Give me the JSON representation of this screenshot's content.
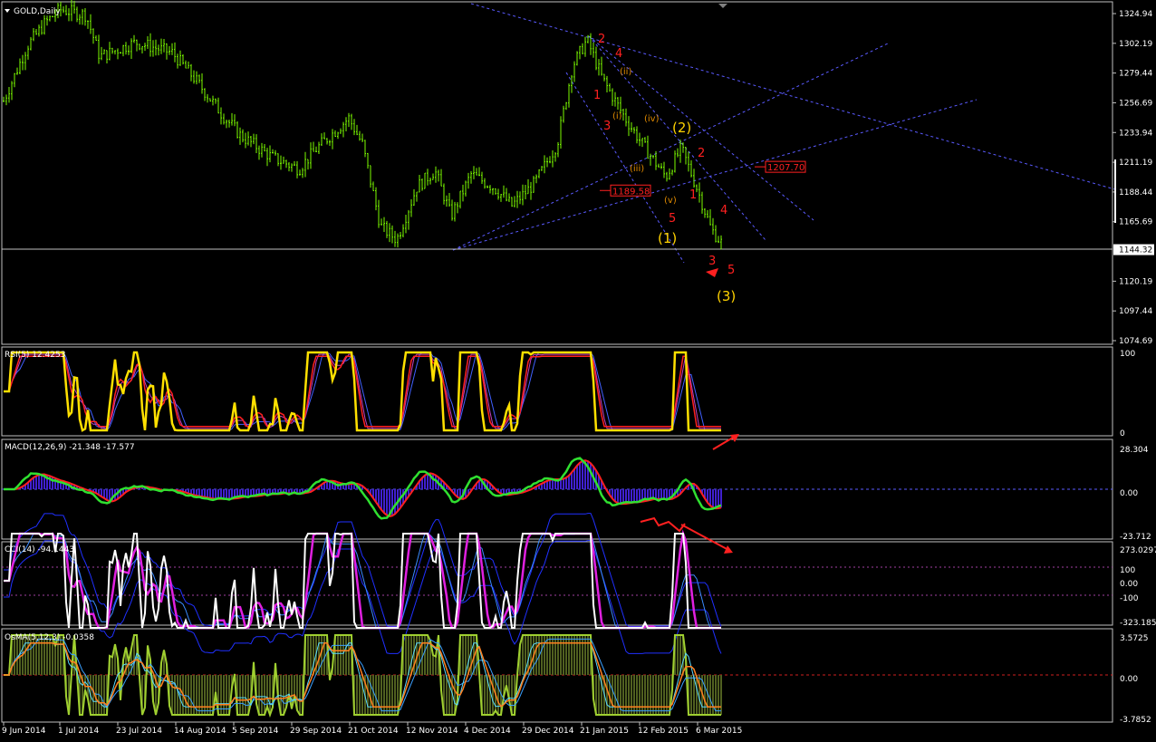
{
  "symbol_label": "GOLD,Daily",
  "colors": {
    "background": "#000000",
    "frame": "#c0c0c0",
    "candle": "#7cfc00",
    "annotation_red": "#ff2020",
    "annotation_yellow": "#ffd200",
    "annotation_orange": "#e08a00",
    "trendline": "#5a5aff",
    "price_line": "#c0c0c0"
  },
  "price_panel": {
    "price_labels": [
      "1324.94",
      "1302.19",
      "1279.44",
      "1256.69",
      "1233.94",
      "1211.19",
      "1188.44",
      "1165.69",
      "1144.32",
      "1120.19",
      "1097.44",
      "1074.69"
    ],
    "current_price": "1144.32",
    "boxed_levels": [
      "1207.70",
      "1189.58"
    ],
    "wave_labels_red": [
      "2",
      "4",
      "1",
      "3",
      "1",
      "2",
      "4",
      "5",
      "3",
      "5"
    ],
    "wave_labels_orange": [
      "(ii)",
      "(i)",
      "(iv)",
      "(iii)",
      "(v)"
    ],
    "wave_labels_yellow": [
      "(2)",
      "(1)",
      "(3)"
    ]
  },
  "indicators": {
    "rsi": {
      "label": "RSI(5) 12.4253",
      "levels": [
        "100",
        "0"
      ]
    },
    "macd": {
      "label": "MACD(12,26,9) -21.348 -17.577",
      "levels": [
        "28.304",
        "0.00",
        "-23.712"
      ]
    },
    "cci": {
      "label": "CCI(14) -94.1443",
      "levels": [
        "273.0297",
        "100",
        "0.00",
        "-100",
        "-323.1851"
      ]
    },
    "osma": {
      "label": "OsMA(5,12,3) -0.0358",
      "levels": [
        "3.5725",
        "0.00",
        "-3.7852"
      ]
    }
  },
  "time_axis": [
    "9 Jun 2014",
    "1 Jul 2014",
    "23 Jul 2014",
    "14 Aug 2014",
    "5 Sep 2014",
    "29 Sep 2014",
    "21 Oct 2014",
    "12 Nov 2014",
    "4 Dec 2014",
    "29 Dec 2014",
    "21 Jan 2015",
    "12 Feb 2015",
    "6 Mar 2015"
  ],
  "chart_data": {
    "type": "line",
    "title": "GOLD,Daily",
    "x": [
      "9 Jun 2014",
      "1 Jul 2014",
      "23 Jul 2014",
      "14 Aug 2014",
      "5 Sep 2014",
      "29 Sep 2014",
      "21 Oct 2014",
      "12 Nov 2014",
      "4 Dec 2014",
      "29 Dec 2014",
      "21 Jan 2015",
      "12 Feb 2015",
      "6 Mar 2015"
    ],
    "series": [
      {
        "values": [
          1255,
          1325,
          1310,
          1300,
          1265,
          1215,
          1240,
          1145,
          1205,
          1180,
          1302,
          1230,
          1150
        ]
      }
    ],
    "ylim": [
      1074.69,
      1324.94
    ],
    "grid": false
  }
}
